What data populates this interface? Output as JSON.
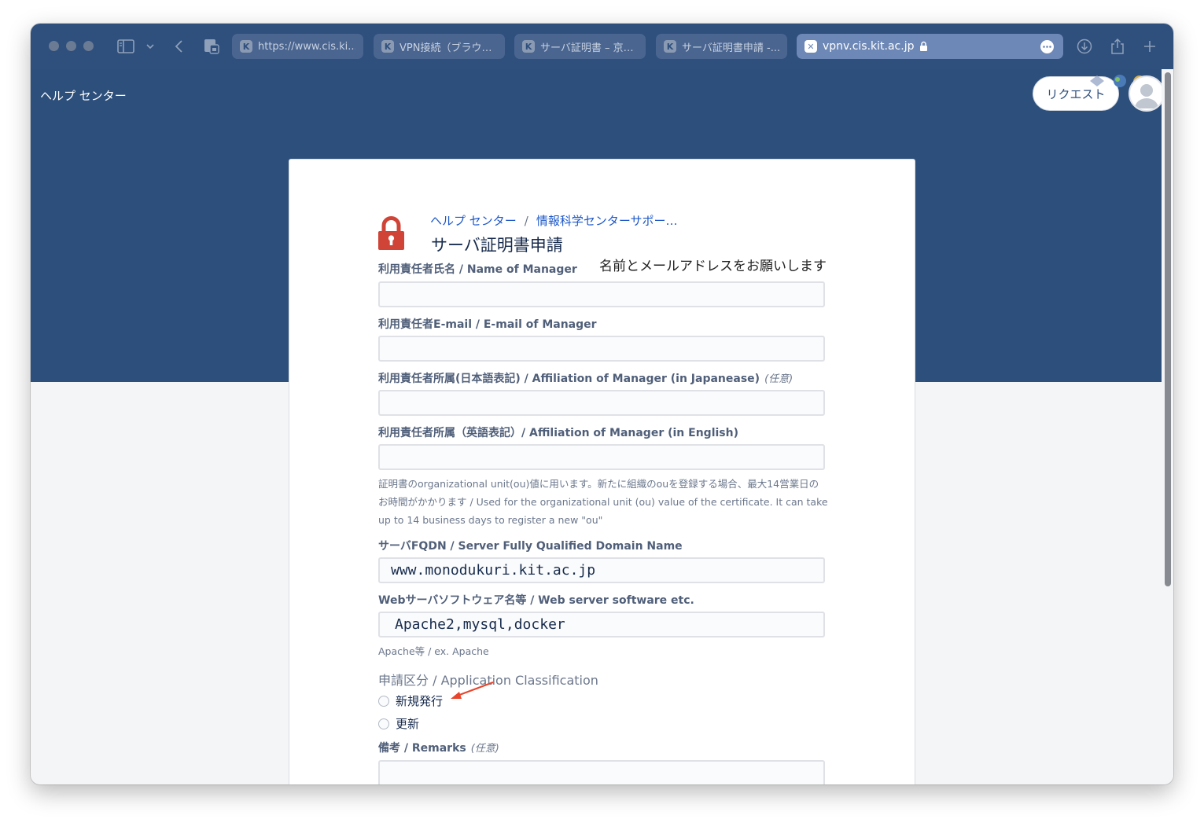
{
  "browser": {
    "tabs": [
      {
        "favicon": "K",
        "label": "https://www.cis.ki..."
      },
      {
        "favicon": "K",
        "label": "VPN接続（ブラウ…"
      },
      {
        "favicon": "K",
        "label": "サーバ証明書 – 京…"
      },
      {
        "favicon": "K",
        "label": "サーバ証明書申請 -..."
      },
      {
        "favicon": "✕",
        "label": "vpnv.cis.kit.ac.jp",
        "active": true
      }
    ],
    "icons": [
      "sidebar-icon",
      "chevron-down-icon",
      "back-icon",
      "shield-icon",
      "lock-icon",
      "more-icon",
      "download-icon",
      "share-icon",
      "plus-icon"
    ]
  },
  "header": {
    "title": "ヘルプ センター",
    "request_button": "リクエスト"
  },
  "breadcrumb": {
    "home": "ヘルプ センター",
    "separator": "/",
    "current": "情報科学センターサポー…"
  },
  "page": {
    "title": "サーバ証明書申請",
    "annotation": "名前とメールアドレスをお願いします"
  },
  "form": {
    "fields": [
      {
        "label": "利用責任者氏名 / Name of Manager",
        "value": ""
      },
      {
        "label": "利用責任者E-mail / E-mail of Manager",
        "value": ""
      },
      {
        "label": "利用責任者所属(日本語表記) / Affiliation of Manager (in Japanease)",
        "optional": "(任意)",
        "value": ""
      },
      {
        "label": "利用責任者所属（英語表記）/ Affiliation of Manager (in English)",
        "value": ""
      },
      {
        "label": "サーバFQDN / Server Fully Qualified Domain Name",
        "value": "www.monodukuri.kit.ac.jp"
      },
      {
        "label": "Webサーバソフトウェア名等 / Web server software etc.",
        "value": "Apache2,mysql,docker"
      },
      {
        "label": "備考 / Remarks",
        "optional": "(任意)",
        "value": ""
      }
    ],
    "affiliation_help": [
      "証明書のorganizational unit(ou)値に用います。新たに組織のouを登録する場合、最大14営業日の",
      "お時間がかかります / Used for the organizational unit (ou) value of the certificate. It can take",
      "up to 14 business days to register a new \"ou\""
    ],
    "software_help": "Apache等 / ex. Apache",
    "classification": {
      "label": "申請区分 / Application Classification",
      "options": [
        "新規発行",
        "更新"
      ]
    }
  },
  "colors": {
    "hero": "#2d4f7c",
    "link": "#1d58c9",
    "annotation_arrow": "#e8452c",
    "lock": "#d04437"
  }
}
